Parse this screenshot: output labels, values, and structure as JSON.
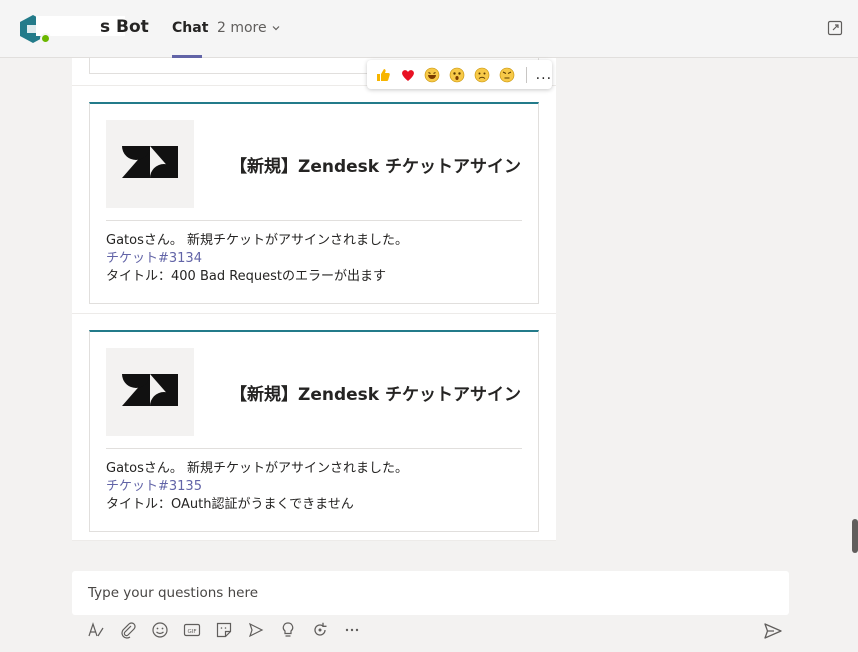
{
  "header": {
    "bot_name": "s Bot",
    "tab_chat": "Chat",
    "more_label": "2 more"
  },
  "reactions": {
    "items": [
      "like",
      "heart",
      "laugh",
      "surprised",
      "sad",
      "angry"
    ],
    "more_label": "..."
  },
  "messages": [
    {
      "card_title": "【新規】Zendesk チケットアサイン",
      "greeting": "Gatosさん。 新規チケットがアサインされました。",
      "ticket_link": "チケット#3134",
      "ticket_title": "タイトル：400 Bad Requestのエラーが出ます"
    },
    {
      "card_title": "【新規】Zendesk チケットアサイン",
      "greeting": "Gatosさん。 新規チケットがアサインされました。",
      "ticket_link": "チケット#3135",
      "ticket_title": "タイトル：OAuth認証がうまくできません"
    }
  ],
  "compose": {
    "placeholder": "Type your questions here"
  },
  "colors": {
    "accent": "#6264a7",
    "card_top": "#237b8a",
    "presence": "#6bb700"
  }
}
